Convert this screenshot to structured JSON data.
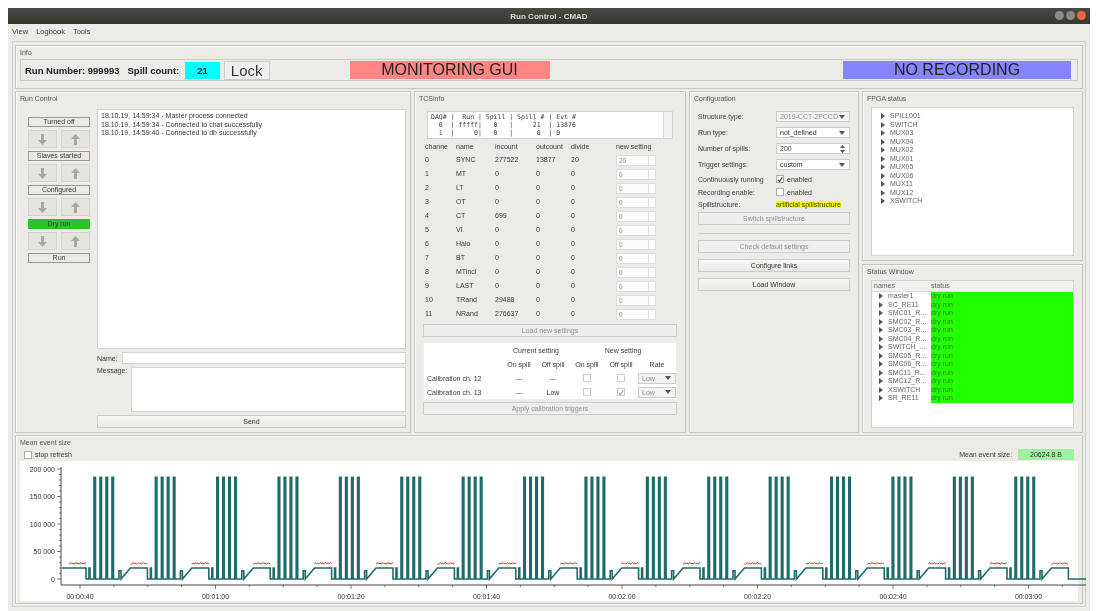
{
  "window": {
    "title": "Run Control - CMAD"
  },
  "menu": [
    {
      "label": "View"
    },
    {
      "label": "Logbook"
    },
    {
      "label": "Tools"
    }
  ],
  "info": {
    "title": "Info",
    "run_number": "Run Number: 999993",
    "spill_count_label": "Spill count:",
    "spill_count": "21",
    "lock_button": "Lock",
    "mode_banner": "MONITORING GUI",
    "recording_banner": "NO RECORDING"
  },
  "run_control": {
    "title": "Run Control",
    "states": [
      {
        "label": "Turned off",
        "active": false
      },
      {
        "label": "Slaves started",
        "active": false
      },
      {
        "label": "Configured",
        "active": false
      },
      {
        "label": "Dry run",
        "active": true
      },
      {
        "label": "Run",
        "active": false
      }
    ],
    "log": [
      "18.10.19, 14:59:34 - Master process connected",
      "18.10.19, 14:59:34 - Connected to chat successfully",
      "18.10.19, 14:59:40 - Connected to db successfully"
    ],
    "name_label": "Name:",
    "message_label": "Message:",
    "send_button": "Send"
  },
  "tcsinfo": {
    "title": "TCSinfo",
    "summary_lines": [
      "DAQ# |  Run | Spill | Spill # | Evt #",
      "  0  | fffff|   0   |     21  | 13876",
      "  1  |     0|   0   |      0  | 0"
    ],
    "columns": [
      "channe",
      "name",
      "incount",
      "outcount",
      "divide",
      "new setting"
    ],
    "rows": [
      {
        "channel": "0",
        "name": "SYNC",
        "incount": "277522",
        "outcount": "13877",
        "divide": "20",
        "new_setting": "20"
      },
      {
        "channel": "1",
        "name": "MT",
        "incount": "0",
        "outcount": "0",
        "divide": "0",
        "new_setting": "0"
      },
      {
        "channel": "2",
        "name": "LT",
        "incount": "0",
        "outcount": "0",
        "divide": "0",
        "new_setting": "0"
      },
      {
        "channel": "3",
        "name": "OT",
        "incount": "0",
        "outcount": "0",
        "divide": "0",
        "new_setting": "0"
      },
      {
        "channel": "4",
        "name": "CT",
        "incount": "699",
        "outcount": "0",
        "divide": "0",
        "new_setting": "0"
      },
      {
        "channel": "5",
        "name": "VI",
        "incount": "0",
        "outcount": "0",
        "divide": "0",
        "new_setting": "0"
      },
      {
        "channel": "6",
        "name": "Halo",
        "incount": "0",
        "outcount": "0",
        "divide": "0",
        "new_setting": "0"
      },
      {
        "channel": "7",
        "name": "BT",
        "incount": "0",
        "outcount": "0",
        "divide": "0",
        "new_setting": "0"
      },
      {
        "channel": "8",
        "name": "MTincl",
        "incount": "0",
        "outcount": "0",
        "divide": "0",
        "new_setting": "0"
      },
      {
        "channel": "9",
        "name": "LAST",
        "incount": "0",
        "outcount": "0",
        "divide": "0",
        "new_setting": "0"
      },
      {
        "channel": "10",
        "name": "TRand",
        "incount": "29488",
        "outcount": "0",
        "divide": "0",
        "new_setting": "0"
      },
      {
        "channel": "11",
        "name": "NRand",
        "incount": "276637",
        "outcount": "0",
        "divide": "0",
        "new_setting": "0"
      }
    ],
    "load_button": {
      "label": "Load new settings",
      "disabled": true
    },
    "calibration": {
      "group_headers": [
        "Current setting",
        "New setting"
      ],
      "columns": [
        "On spill",
        "Off spill",
        "On spill",
        "Off spill",
        "Rate"
      ],
      "rows": [
        {
          "label": "Calibration ch. 12",
          "current_on": "---",
          "current_off": "---",
          "new_on": false,
          "new_off": false,
          "rate": "Low"
        },
        {
          "label": "Calibration ch. 13",
          "current_on": "---",
          "current_off": "Low",
          "new_on": false,
          "new_off": true,
          "rate": "Low"
        }
      ],
      "apply_button": {
        "label": "Apply calibration triggers",
        "disabled": true
      }
    }
  },
  "configuration": {
    "title": "Configuration",
    "fields": [
      {
        "kind": "combo",
        "label": "Structure type:",
        "value": "2019-CCT-2PCCD",
        "disabled": true
      },
      {
        "kind": "combo",
        "label": "Run type:",
        "value": "not_defined",
        "disabled": false
      },
      {
        "kind": "spin",
        "label": "Number of spills:",
        "value": "200",
        "disabled": false
      },
      {
        "kind": "combo",
        "label": "Trigger settings:",
        "value": "custom",
        "disabled": false
      },
      {
        "kind": "check",
        "label": "Continuously running",
        "value": "enabled",
        "checked": true
      },
      {
        "kind": "check",
        "label": "Recording enable:",
        "value": "enabled",
        "checked": false
      },
      {
        "kind": "highlight",
        "label": "Spillstructure:",
        "value": "artificial spillstructure"
      }
    ],
    "buttons": [
      {
        "label": "Switch spillstructure",
        "disabled": true
      },
      {
        "label": "Check default settings",
        "disabled": true
      },
      {
        "label": "Configure links",
        "disabled": false
      },
      {
        "label": "Load Window",
        "disabled": false
      }
    ]
  },
  "fpga_status": {
    "title": "FPGA status",
    "items": [
      {
        "label": "SPILL001",
        "expanded": false
      },
      {
        "label": "SWITCH",
        "expanded": false
      },
      {
        "label": "MUX03",
        "expanded": false
      },
      {
        "label": "MUX04",
        "expanded": false
      },
      {
        "label": "MUX02",
        "expanded": false
      },
      {
        "label": "MUX01",
        "expanded": false
      },
      {
        "label": "MUX05",
        "expanded": false
      },
      {
        "label": "MUX06",
        "expanded": false
      },
      {
        "label": "MUX11",
        "expanded": false
      },
      {
        "label": "MUX12",
        "expanded": false
      },
      {
        "label": "XSWITCH",
        "expanded": false
      }
    ]
  },
  "status_window": {
    "title": "Status Window",
    "columns": [
      "names",
      "status"
    ],
    "rows": [
      {
        "name": "master1",
        "status": "dry run",
        "color": "#22ff00",
        "expanded": false
      },
      {
        "name": "SC_RE11",
        "status": "dry run",
        "color": "#22ff00",
        "expanded": false
      },
      {
        "name": "SMC01_R...",
        "status": "dry run",
        "color": "#22ff00",
        "expanded": false
      },
      {
        "name": "SMC02_R...",
        "status": "dry run",
        "color": "#22ff00",
        "expanded": false
      },
      {
        "name": "SMC03_R...",
        "status": "dry run",
        "color": "#22ff00",
        "expanded": false
      },
      {
        "name": "SMC04_R...",
        "status": "dry run",
        "color": "#22ff00",
        "expanded": false
      },
      {
        "name": "SWITCH_...",
        "status": "dry run",
        "color": "#22ff00",
        "expanded": false
      },
      {
        "name": "SMC05_R...",
        "status": "dry run",
        "color": "#22ff00",
        "expanded": false
      },
      {
        "name": "SMC06_R...",
        "status": "dry run",
        "color": "#22ff00",
        "expanded": false
      },
      {
        "name": "SMC11_R...",
        "status": "dry run",
        "color": "#22ff00",
        "expanded": false
      },
      {
        "name": "SMC12_R...",
        "status": "dry run",
        "color": "#22ff00",
        "expanded": false
      },
      {
        "name": "XSWITCH",
        "status": "dry run",
        "color": "#22ff00",
        "expanded": false
      },
      {
        "name": "SR_RE11",
        "status": "dry run",
        "color": "#22ff00",
        "expanded": false
      }
    ]
  },
  "mean_event_size": {
    "title": "Mean event size",
    "stop_refresh": {
      "label": "stop refresh",
      "checked": false
    },
    "value_label": "Mean event size:",
    "value": "20624.8 B",
    "y_tick_labels": [
      "200 000",
      "150 000",
      "100 000",
      "50 000",
      "0"
    ],
    "x_tick_labels": [
      "00:00:40",
      "00:01:00",
      "00:01:20",
      "00:01:40",
      "00:02:00",
      "00:02:20",
      "00:02:40",
      "00:03:00"
    ]
  }
}
